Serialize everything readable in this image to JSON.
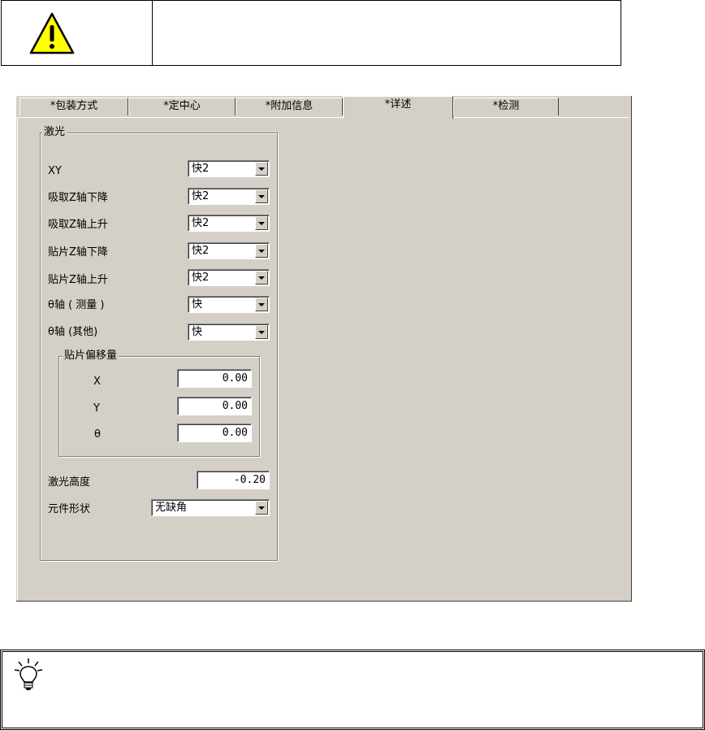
{
  "tabs": [
    {
      "label": "*包装方式",
      "active": false
    },
    {
      "label": "*定中心",
      "active": false
    },
    {
      "label": "*附加信息",
      "active": false
    },
    {
      "label": "*详述",
      "active": true
    },
    {
      "label": "*检测",
      "active": false
    }
  ],
  "laser_group": {
    "title": "激光",
    "rows": [
      {
        "label": "XY",
        "value": "快2"
      },
      {
        "label": "吸取Z轴下降",
        "value": "快2"
      },
      {
        "label": "吸取Z轴上升",
        "value": "快2"
      },
      {
        "label": "贴片Z轴下降",
        "value": "快2"
      },
      {
        "label": "贴片Z轴上升",
        "value": "快2"
      },
      {
        "label": "θ轴 ( 测量 )",
        "value": "快"
      },
      {
        "label": "θ轴 (其他)",
        "value": "快"
      }
    ]
  },
  "offset_group": {
    "title": "贴片偏移量",
    "x": {
      "label": "X",
      "value": "0.00"
    },
    "y": {
      "label": "Y",
      "value": "0.00"
    },
    "theta": {
      "label": "θ",
      "value": "0.00"
    }
  },
  "laser_height": {
    "label": "激光高度",
    "value": "-0.20"
  },
  "component_shape": {
    "label": "元件形状",
    "value": "无缺角"
  },
  "icons": {
    "warning": "warning-icon",
    "tip": "lightbulb-icon"
  },
  "colors": {
    "dialog_bg": "#d4d0c8",
    "warning_fill": "#ffff00"
  }
}
